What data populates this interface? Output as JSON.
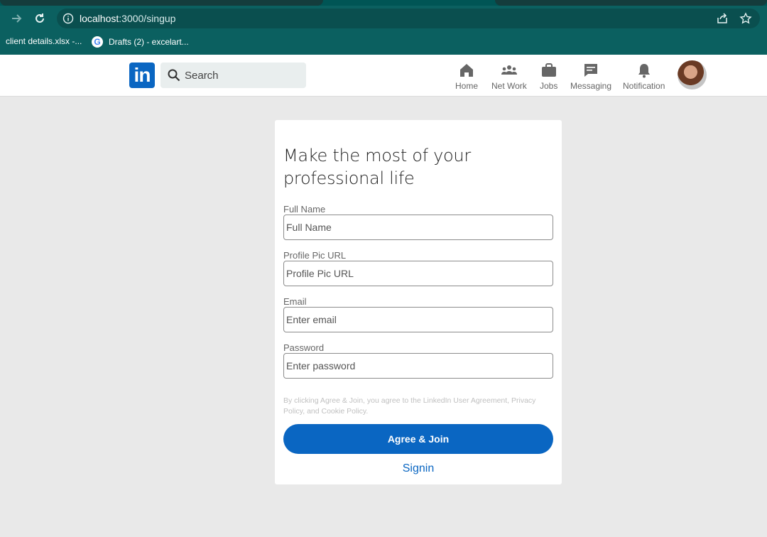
{
  "browser": {
    "url_host": "localhost",
    "url_rest": ":3000/singup",
    "bookmarks": [
      "client details.xlsx -...",
      "Drafts (2) - excelart..."
    ]
  },
  "header": {
    "logo_text": "in",
    "search_placeholder": "Search",
    "nav": [
      {
        "label": "Home",
        "icon": "home-icon"
      },
      {
        "label": "Net Work",
        "icon": "network-icon"
      },
      {
        "label": "Jobs",
        "icon": "briefcase-icon"
      },
      {
        "label": "Messaging",
        "icon": "message-icon"
      },
      {
        "label": "Notification",
        "icon": "bell-icon"
      }
    ]
  },
  "form": {
    "title": "Make the most of your professional life",
    "fields": [
      {
        "label": "Full Name",
        "placeholder": "Full Name"
      },
      {
        "label": "Profile Pic URL",
        "placeholder": "Profile Pic URL"
      },
      {
        "label": "Email",
        "placeholder": "Enter email"
      },
      {
        "label": "Password",
        "placeholder": "Enter password"
      }
    ],
    "legal": "By clicking Agree & Join, you agree to the LinkedIn User Agreement, Privacy Policy, and Cookie Policy.",
    "submit_label": "Agree & Join",
    "signin_label": "Signin"
  },
  "colors": {
    "brand": "#0a66c2",
    "browser_chrome": "#0b6060"
  }
}
